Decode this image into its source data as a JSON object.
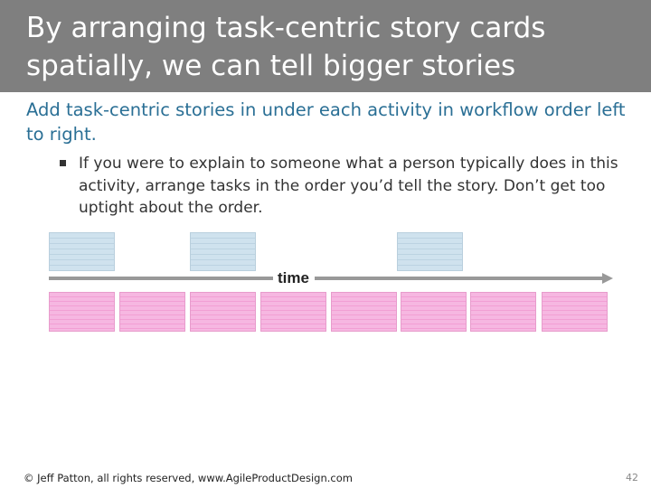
{
  "slide": {
    "title": "By arranging task-centric story cards spatially, we can tell bigger stories",
    "bullet_level1": "Add task-centric stories in under each activity in workflow order left to right.",
    "bullet_level2": "If you were to explain to someone what a person typically does in this activity, arrange tasks in the order you’d tell the story.  Don’t get too uptight about the order.",
    "diagram": {
      "time_label": "time",
      "activity_card_count": 3,
      "task_card_count": 8
    },
    "footer": "© Jeff Patton, all rights reserved, www.AgileProductDesign.com",
    "page_number": "42"
  },
  "colors": {
    "title_bar": "#7f7f7f",
    "heading_text": "#2a6f95",
    "activity_card": "#cfe2ee",
    "task_card": "#f6b7e1",
    "timeline": "#999999"
  }
}
